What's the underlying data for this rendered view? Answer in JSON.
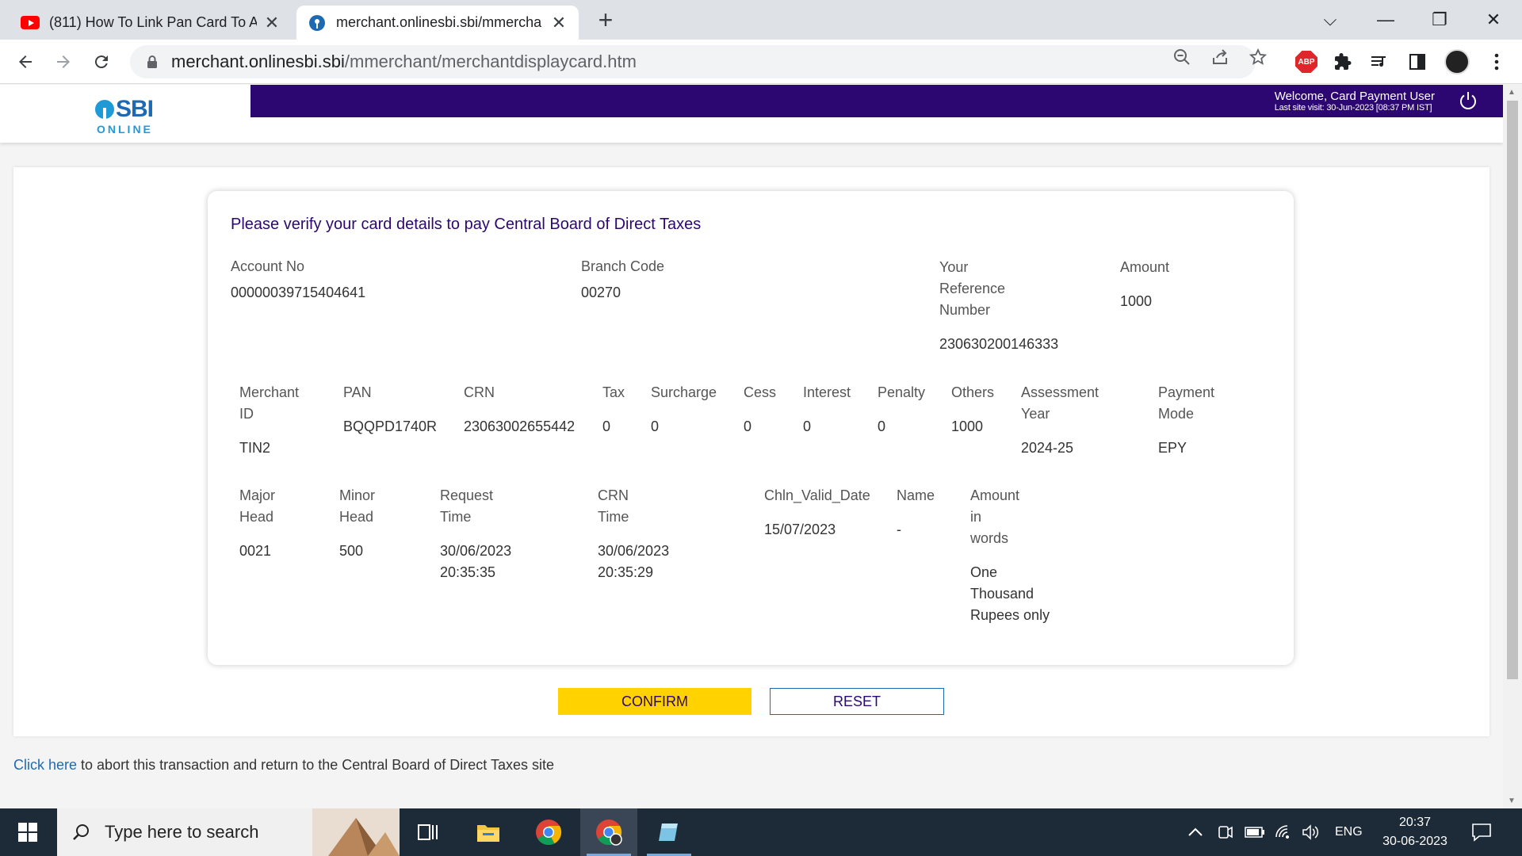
{
  "browser": {
    "tabs": [
      {
        "title": "(811) How To Link Pan Card To A",
        "favicon": "youtube-icon",
        "active": false
      },
      {
        "title": "merchant.onlinesbi.sbi/mmercha",
        "favicon": "sbi-favicon",
        "active": true
      }
    ],
    "url_domain": "merchant.onlinesbi.sbi",
    "url_path": "/mmerchant/merchantdisplaycard.htm",
    "abp_label": "ABP"
  },
  "header": {
    "logo_main": "SBI",
    "logo_sub": "ONLINE",
    "welcome": "Welcome, Card Payment User",
    "last_visit": "Last site visit: 30-Jun-2023 [08:37 PM IST]",
    "bar_color": "#2c0772"
  },
  "card": {
    "heading": "Please verify your card details to pay Central Board of Direct Taxes",
    "account_no_label": "Account No",
    "account_no": "00000039715404641",
    "branch_code_label": "Branch Code",
    "branch_code": "00270",
    "ref_label_1": "Your",
    "ref_label_2": "Reference",
    "ref_label_3": "Number",
    "ref_number": "230630200146333",
    "amount_label": "Amount",
    "amount": "1000",
    "merchant_id_label_1": "Merchant",
    "merchant_id_label_2": "ID",
    "merchant_id": "TIN2",
    "pan_label": "PAN",
    "pan": "BQQPD1740R",
    "crn_label": "CRN",
    "crn": "23063002655442",
    "tax_label": "Tax",
    "tax": "0",
    "surcharge_label": "Surcharge",
    "surcharge": "0",
    "cess_label": "Cess",
    "cess": "0",
    "interest_label": "Interest",
    "interest": "0",
    "penalty_label": "Penalty",
    "penalty": "0",
    "others_label": "Others",
    "others": "1000",
    "ay_label_1": "Assessment",
    "ay_label_2": "Year",
    "assessment_year": "2024-25",
    "pm_label_1": "Payment",
    "pm_label_2": "Mode",
    "payment_mode": "EPY",
    "major_head_label_1": "Major",
    "major_head_label_2": "Head",
    "major_head": "0021",
    "minor_head_label_1": "Minor",
    "minor_head_label_2": "Head",
    "minor_head": "500",
    "req_time_label_1": "Request",
    "req_time_label_2": "Time",
    "req_time_date": "30/06/2023",
    "req_time_time": "20:35:35",
    "crn_time_label_1": "CRN",
    "crn_time_label_2": "Time",
    "crn_time_date": "30/06/2023",
    "crn_time_time": "20:35:29",
    "chln_label": "Chln_Valid_Date",
    "chln_valid_date": "15/07/2023",
    "name_label": "Name",
    "name": "-",
    "aiw_label_1": "Amount",
    "aiw_label_2": "in",
    "aiw_label_3": "words",
    "aiw_1": "One",
    "aiw_2": "Thousand",
    "aiw_3": "Rupees only"
  },
  "buttons": {
    "confirm": "CONFIRM",
    "reset": "RESET",
    "confirm_color": "#ffd200"
  },
  "footer": {
    "link": "Click here",
    "text": " to abort this transaction and return to the Central Board of Direct Taxes site"
  },
  "taskbar": {
    "search_placeholder": "Type here to search",
    "lang": "ENG",
    "time": "20:37",
    "date": "30-06-2023"
  }
}
